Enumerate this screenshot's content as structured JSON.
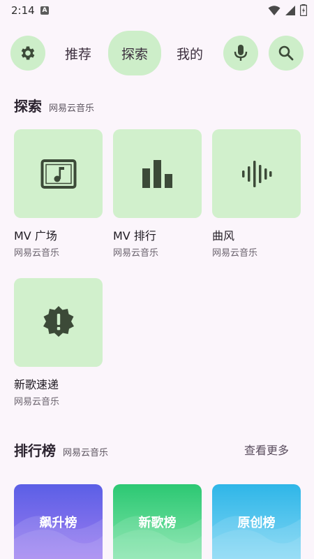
{
  "status": {
    "time": "2:14",
    "a_badge": "A"
  },
  "nav": {
    "tabs": [
      {
        "label": "推荐"
      },
      {
        "label": "探索"
      },
      {
        "label": "我的"
      }
    ]
  },
  "explore": {
    "title": "探索",
    "subtitle": "网易云音乐",
    "tiles": [
      {
        "title": "MV 广场",
        "subtitle": "网易云音乐",
        "icon": "music-video-icon"
      },
      {
        "title": "MV 排行",
        "subtitle": "网易云音乐",
        "icon": "bar-chart-icon"
      },
      {
        "title": "曲风",
        "subtitle": "网易云音乐",
        "icon": "sound-wave-icon"
      },
      {
        "title": "新歌速递",
        "subtitle": "网易云音乐",
        "icon": "new-releases-icon"
      }
    ]
  },
  "charts": {
    "title": "排行榜",
    "subtitle": "网易云音乐",
    "more": "查看更多",
    "cards": [
      {
        "label": "飙升榜",
        "color_top": "#5b5fe6",
        "color_bottom": "#9b7cf0"
      },
      {
        "label": "新歌榜",
        "color_top": "#2cc873",
        "color_bottom": "#7fe4a8"
      },
      {
        "label": "原创榜",
        "color_top": "#2fb6e8",
        "color_bottom": "#7fd6f4"
      }
    ]
  },
  "colors": {
    "accent_bg": "#cdeec9",
    "icon_fg": "#3c4a38",
    "page_bg": "#fbf5fb"
  }
}
